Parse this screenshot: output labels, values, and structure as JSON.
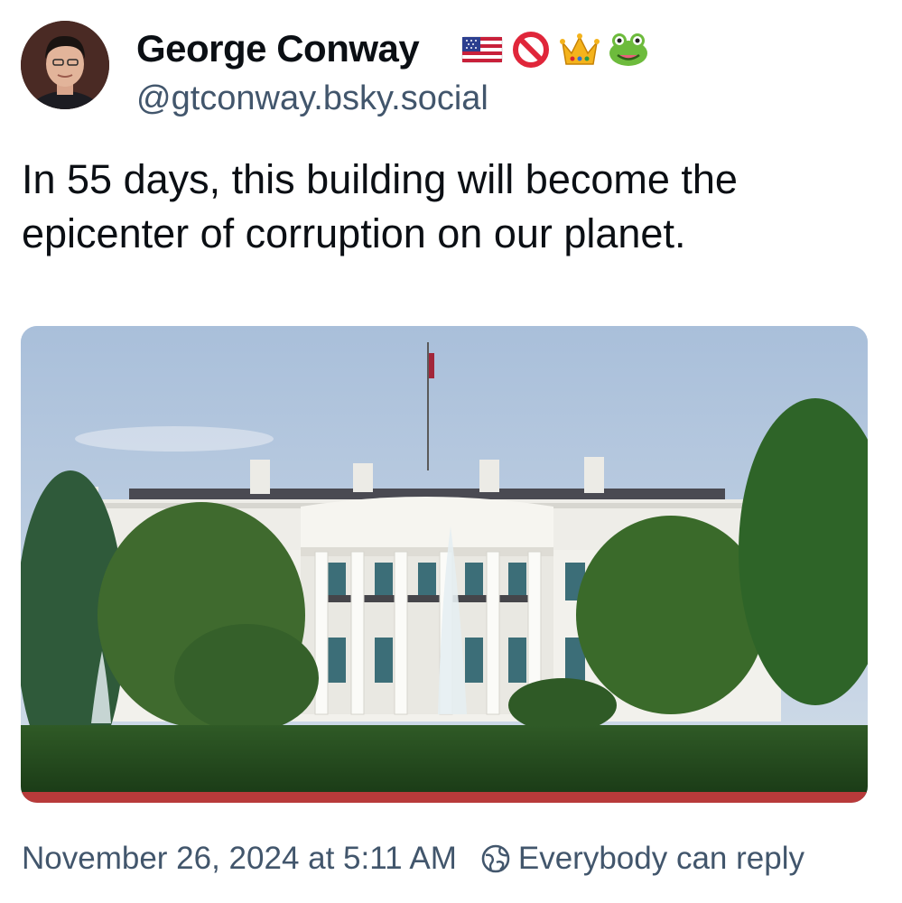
{
  "author": {
    "display_name": "George Conway",
    "handle": "@gtconway.bsky.social",
    "name_emojis": [
      "flag-usa-icon",
      "prohibited-icon",
      "crown-icon",
      "frog-icon"
    ]
  },
  "post": {
    "text": "In 55 days, this building will become the epicenter of corruption on our planet.",
    "image_subject": "white-house-photo"
  },
  "footer": {
    "timestamp": "November 26, 2024 at 5:11 AM",
    "reply_setting": "Everybody can reply",
    "reply_icon": "globe-icon"
  },
  "colors": {
    "text": "#0b0f14",
    "secondary_text": "#42566c"
  }
}
